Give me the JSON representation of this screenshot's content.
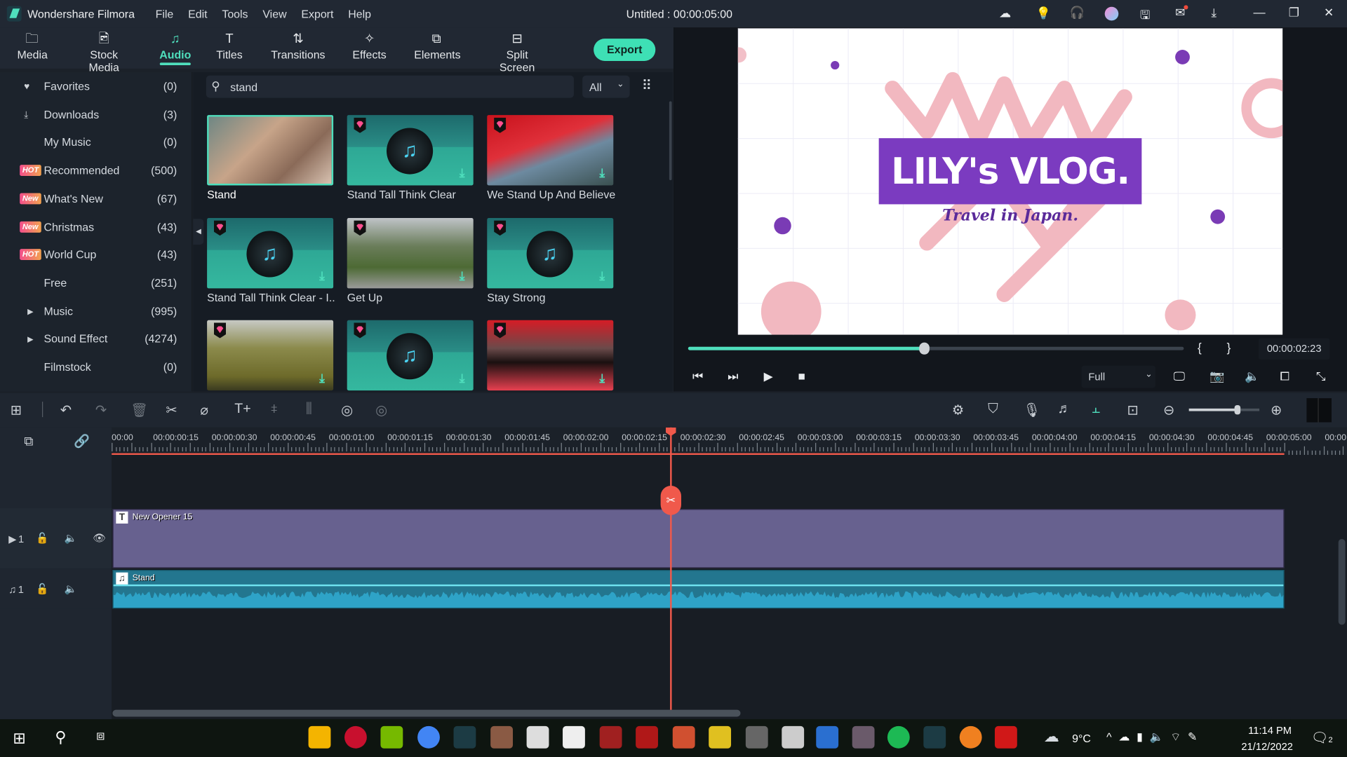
{
  "app": {
    "name": "Wondershare Filmora",
    "project_title": "Untitled : 00:00:05:00",
    "menu": [
      "File",
      "Edit",
      "Tools",
      "View",
      "Export",
      "Help"
    ],
    "title_icons": [
      "cloud-icon",
      "lightbulb-icon",
      "headset-icon",
      "avatar",
      "save-icon",
      "mail-icon",
      "download-icon"
    ],
    "window_controls": [
      "minimize",
      "restore",
      "close"
    ]
  },
  "tabs": [
    {
      "label": "Media",
      "icon": "folder-icon"
    },
    {
      "label": "Stock Media",
      "icon": "stock-icon"
    },
    {
      "label": "Audio",
      "icon": "music-icon",
      "active": true
    },
    {
      "label": "Titles",
      "icon": "text-icon"
    },
    {
      "label": "Transitions",
      "icon": "transition-icon"
    },
    {
      "label": "Effects",
      "icon": "effects-icon"
    },
    {
      "label": "Elements",
      "icon": "elements-icon"
    },
    {
      "label": "Split Screen",
      "icon": "split-screen-icon"
    }
  ],
  "export_label": "Export",
  "accent": "#4fdfbd",
  "sidebar": [
    {
      "label": "Favorites",
      "count": "(0)",
      "icon": "heart-icon"
    },
    {
      "label": "Downloads",
      "count": "(3)",
      "icon": "download-icon"
    },
    {
      "label": "My Music",
      "count": "(0)"
    },
    {
      "label": "Recommended",
      "count": "(500)",
      "badge": "HOT"
    },
    {
      "label": "What's New",
      "count": "(67)",
      "badge": "New"
    },
    {
      "label": "Christmas",
      "count": "(43)",
      "badge": "New"
    },
    {
      "label": "World Cup",
      "count": "(43)",
      "badge": "HOT"
    },
    {
      "label": "Free",
      "count": "(251)"
    },
    {
      "label": "Music",
      "count": "(995)",
      "expandable": true
    },
    {
      "label": "Sound Effect",
      "count": "(4274)",
      "expandable": true
    },
    {
      "label": "Filmstock",
      "count": "(0)"
    }
  ],
  "search": {
    "value": "stand",
    "filter": "All"
  },
  "grid": [
    {
      "title": "Stand",
      "kind": "photo-woman",
      "selected": true
    },
    {
      "title": "Stand Tall Think Clear",
      "kind": "music"
    },
    {
      "title": "We Stand Up And Believe",
      "kind": "photo-red-river"
    },
    {
      "title": "Stand Tall Think Clear - I...",
      "kind": "music"
    },
    {
      "title": "Get Up",
      "kind": "photo-runner"
    },
    {
      "title": "Stay Strong",
      "kind": "music"
    },
    {
      "title": "",
      "kind": "photo-road"
    },
    {
      "title": "",
      "kind": "music"
    },
    {
      "title": "",
      "kind": "photo-red-bridge"
    }
  ],
  "preview": {
    "title": "LILY's VLOG.",
    "subtitle": "Travel in Japan.",
    "time": "00:00:02:23",
    "progress": 0.477,
    "quality": "Full",
    "brackets": [
      "{",
      "}"
    ]
  },
  "timeline": {
    "ruler": [
      "00:00",
      "00:00:00:15",
      "00:00:00:30",
      "00:00:00:45",
      "00:00:01:00",
      "00:00:01:15",
      "00:00:01:30",
      "00:00:01:45",
      "00:00:02:00",
      "00:00:02:15",
      "00:00:02:30",
      "00:00:02:45",
      "00:00:03:00",
      "00:00:03:15",
      "00:00:03:30",
      "00:00:03:45",
      "00:00:04:00",
      "00:00:04:15",
      "00:00:04:30",
      "00:00:04:45",
      "00:00:05:00",
      "00:00:0"
    ],
    "video_track": {
      "number": "1",
      "clip": "New Opener 15",
      "color": "#67618f"
    },
    "audio_track": {
      "number": "1",
      "clip": "Stand",
      "color": "#23768f"
    },
    "playhead": "00:00:02:23"
  },
  "taskbar": {
    "weather": "9°C",
    "time": "11:14 PM",
    "date": "21/12/2022",
    "notifications": "2"
  }
}
